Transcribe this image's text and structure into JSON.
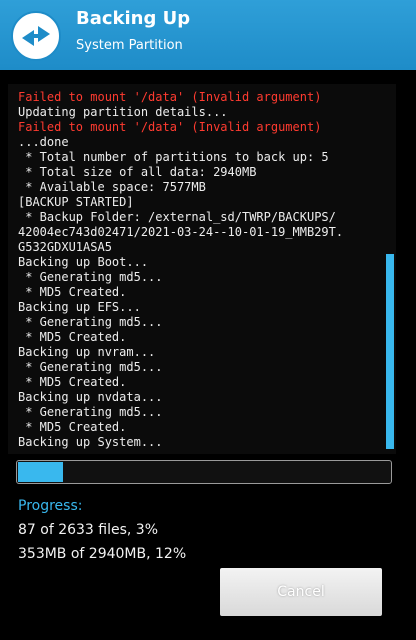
{
  "header": {
    "title": "Backing Up",
    "subtitle": "System Partition",
    "bg_color": "#1e8cc8",
    "logo_icon": "twrp-logo-icon"
  },
  "console": {
    "lines": [
      {
        "text": "Failed to mount '/data' (Invalid argument)",
        "type": "error"
      },
      {
        "text": "Updating partition details...",
        "type": "info"
      },
      {
        "text": "Failed to mount '/data' (Invalid argument)",
        "type": "error"
      },
      {
        "text": "...done",
        "type": "info"
      },
      {
        "text": " * Total number of partitions to back up: 5",
        "type": "info"
      },
      {
        "text": " * Total size of all data: 2940MB",
        "type": "info"
      },
      {
        "text": " * Available space: 7577MB",
        "type": "info"
      },
      {
        "text": "[BACKUP STARTED]",
        "type": "info"
      },
      {
        "text": " * Backup Folder: /external_sd/TWRP/BACKUPS/",
        "type": "info"
      },
      {
        "text": "42004ec743d02471/2021-03-24--10-01-19_MMB29T.",
        "type": "info"
      },
      {
        "text": "G532GDXU1ASA5",
        "type": "info"
      },
      {
        "text": "Backing up Boot...",
        "type": "info"
      },
      {
        "text": " * Generating md5...",
        "type": "info"
      },
      {
        "text": " * MD5 Created.",
        "type": "info"
      },
      {
        "text": "Backing up EFS...",
        "type": "info"
      },
      {
        "text": " * Generating md5...",
        "type": "info"
      },
      {
        "text": " * MD5 Created.",
        "type": "info"
      },
      {
        "text": "Backing up nvram...",
        "type": "info"
      },
      {
        "text": " * Generating md5...",
        "type": "info"
      },
      {
        "text": " * MD5 Created.",
        "type": "info"
      },
      {
        "text": "Backing up nvdata...",
        "type": "info"
      },
      {
        "text": " * Generating md5...",
        "type": "info"
      },
      {
        "text": " * MD5 Created.",
        "type": "info"
      },
      {
        "text": "Backing up System...",
        "type": "info"
      }
    ],
    "error_color": "#ff3b30",
    "text_color": "#ededed",
    "scroll_position": 0.62
  },
  "progress": {
    "fraction": 0.12,
    "label": "Progress:",
    "files": "87 of 2633 files, 3%",
    "size": "353MB of 2940MB, 12%",
    "accent_color": "#39b8ee"
  },
  "actions": {
    "cancel_label": "Cancel"
  }
}
